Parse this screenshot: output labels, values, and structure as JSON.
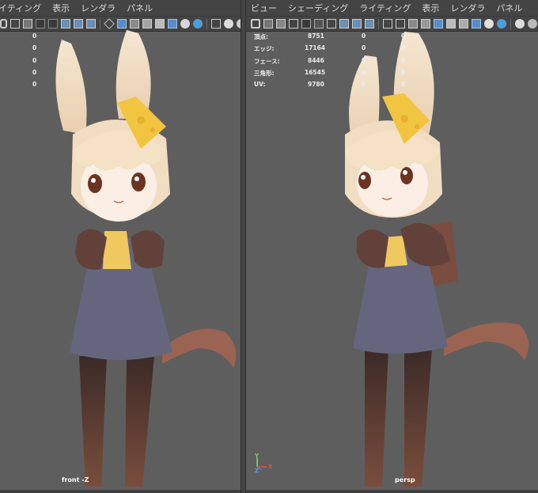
{
  "left_viewport": {
    "menu": [
      "イティング",
      "表示",
      "レンダラ",
      "パネル"
    ],
    "hud_values": [
      "0",
      "0",
      "0",
      "0",
      "0"
    ],
    "camera_label": "front -Z"
  },
  "right_viewport": {
    "menu": [
      "ビュー",
      "シェーディング",
      "ライティング",
      "表示",
      "レンダラ",
      "パネル"
    ],
    "hud": {
      "rows": [
        {
          "label": "頂点:",
          "value": "8751",
          "a": "0",
          "b": "0"
        },
        {
          "label": "エッジ:",
          "value": "17164",
          "a": "0",
          "b": "0"
        },
        {
          "label": "フェース:",
          "value": "8446",
          "a": "0",
          "b": "0"
        },
        {
          "label": "三角形:",
          "value": "16545",
          "a": "0",
          "b": "0"
        },
        {
          "label": "UV:",
          "value": "9780",
          "a": "0",
          "b": "0"
        }
      ]
    },
    "camera_label": "persp",
    "axis_labels": {
      "y": "Y",
      "z": "Z",
      "x": "X"
    }
  },
  "colors": {
    "viewport_bg": "#5e5e5e",
    "menubar_bg": "#444444",
    "active_icon": "#5b8cc9"
  }
}
